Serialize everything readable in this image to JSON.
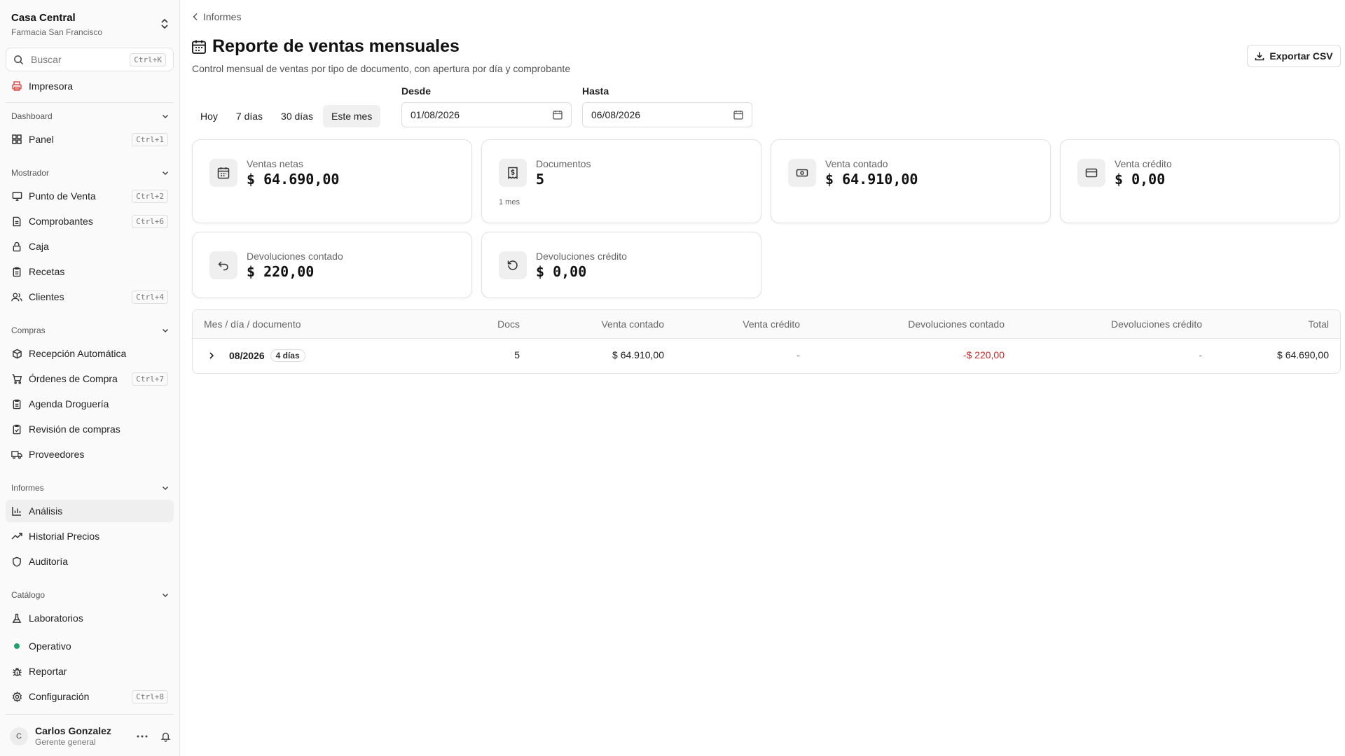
{
  "org": {
    "name": "Casa Central",
    "subtitle": "Farmacia San Francisco"
  },
  "search": {
    "placeholder": "Buscar",
    "shortcut": "Ctrl+K"
  },
  "printer": {
    "label": "Impresora"
  },
  "sections": {
    "dashboard": "Dashboard",
    "mostrador": "Mostrador",
    "compras": "Compras",
    "informes": "Informes",
    "catalogo": "Catálogo"
  },
  "nav": {
    "panel": {
      "label": "Panel",
      "shortcut": "Ctrl+1"
    },
    "punto_venta": {
      "label": "Punto de Venta",
      "shortcut": "Ctrl+2"
    },
    "comprobantes": {
      "label": "Comprobantes",
      "shortcut": "Ctrl+6"
    },
    "caja": {
      "label": "Caja"
    },
    "recetas": {
      "label": "Recetas"
    },
    "clientes": {
      "label": "Clientes",
      "shortcut": "Ctrl+4"
    },
    "recepcion": {
      "label": "Recepción Automática"
    },
    "ordenes": {
      "label": "Órdenes de Compra",
      "shortcut": "Ctrl+7"
    },
    "agenda": {
      "label": "Agenda Droguería"
    },
    "revision": {
      "label": "Revisión de compras"
    },
    "proveedores": {
      "label": "Proveedores"
    },
    "analisis": {
      "label": "Análisis"
    },
    "historial": {
      "label": "Historial Precios"
    },
    "auditoria": {
      "label": "Auditoría"
    },
    "laboratorios": {
      "label": "Laboratorios"
    }
  },
  "footer": {
    "status": "Operativo",
    "status_color": "#22a06b",
    "report": "Reportar",
    "config": {
      "label": "Configuración",
      "shortcut": "Ctrl+8"
    }
  },
  "user": {
    "initial": "C",
    "name": "Carlos Gonzalez",
    "role": "Gerente general"
  },
  "breadcrumb": "Informes",
  "page": {
    "title": "Reporte de ventas mensuales",
    "subtitle": "Control mensual de ventas por tipo de documento, con apertura por día y comprobante",
    "export_label": "Exportar CSV"
  },
  "filters": {
    "presets": [
      "Hoy",
      "7 días",
      "30 días",
      "Este mes"
    ],
    "active_preset": "Este mes",
    "from_label": "Desde",
    "from_value": "01/08/2026",
    "to_label": "Hasta",
    "to_value": "06/08/2026"
  },
  "cards": {
    "ventas_netas": {
      "label": "Ventas netas",
      "value": "$ 64.690,00"
    },
    "documentos": {
      "label": "Documentos",
      "value": "5",
      "note": "1 mes"
    },
    "venta_contado": {
      "label": "Venta contado",
      "value": "$ 64.910,00"
    },
    "venta_credito": {
      "label": "Venta crédito",
      "value": "$ 0,00"
    },
    "dev_contado": {
      "label": "Devoluciones contado",
      "value": "$ 220,00"
    },
    "dev_credito": {
      "label": "Devoluciones crédito",
      "value": "$ 0,00"
    }
  },
  "table": {
    "headers": {
      "mes": "Mes / día / documento",
      "docs": "Docs",
      "venta_contado": "Venta contado",
      "venta_credito": "Venta crédito",
      "dev_contado": "Devoluciones contado",
      "dev_credito": "Devoluciones crédito",
      "total": "Total"
    },
    "rows": [
      {
        "mes": "08/2026",
        "dias": "4 días",
        "docs": "5",
        "venta_contado": "$ 64.910,00",
        "venta_credito": "-",
        "dev_contado": "-$ 220,00",
        "dev_credito": "-",
        "total": "$ 64.690,00"
      }
    ]
  },
  "colors": {
    "negative": "#c62828",
    "status_ok": "#22a06b"
  }
}
